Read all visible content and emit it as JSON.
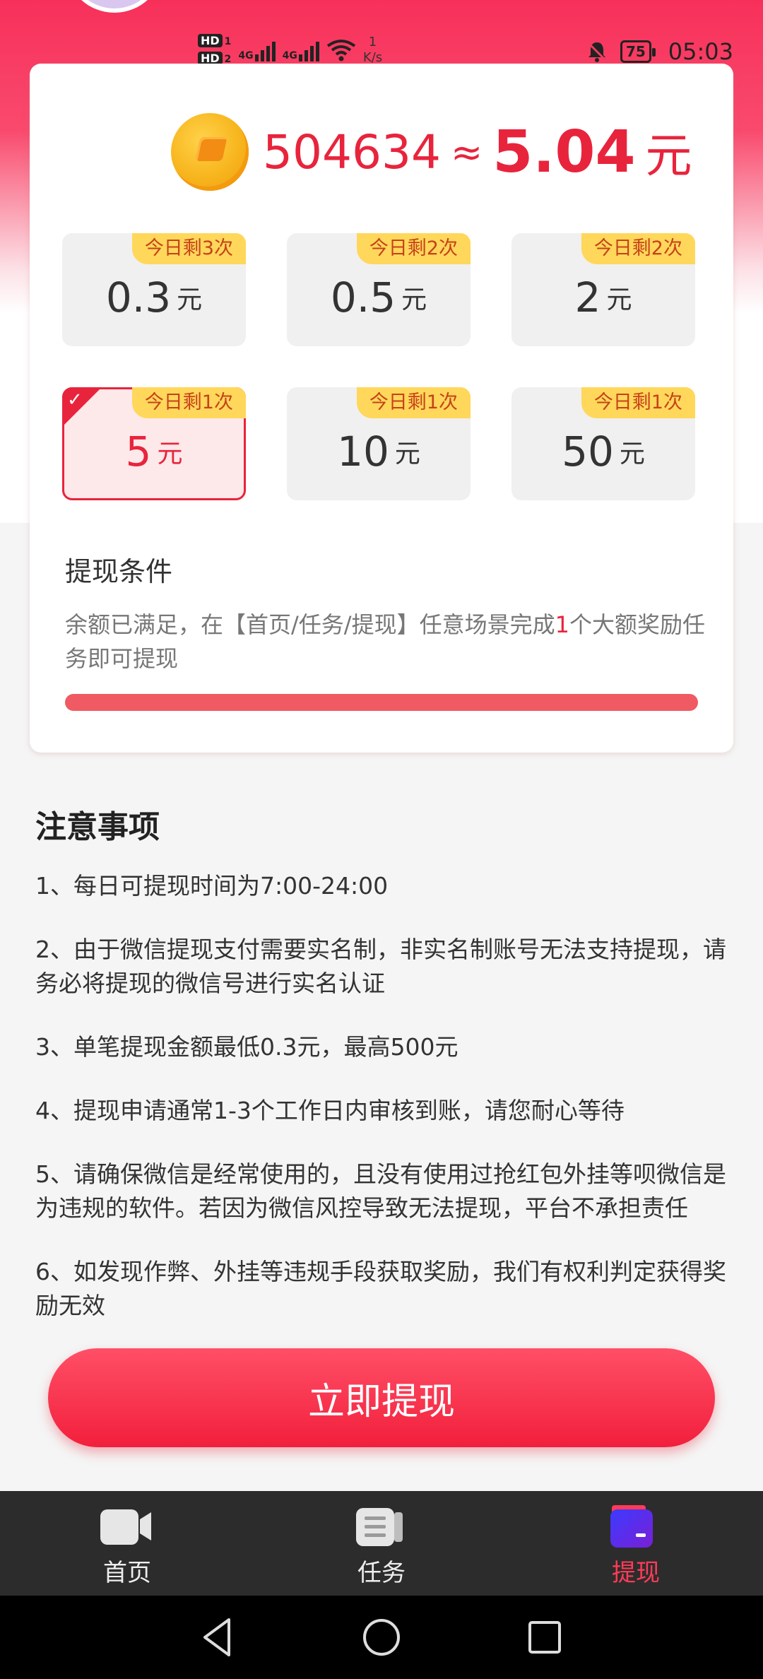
{
  "status_bar": {
    "hd1": "HD",
    "hd1_sub": "1",
    "hd2": "HD",
    "hd2_sub": "2",
    "net1": "4G",
    "net2": "4G",
    "speed_value": "1",
    "speed_unit": "K/s",
    "battery": "75",
    "time": "05:03"
  },
  "balance": {
    "coins": "504634",
    "approx": "≈",
    "amount": "5.04",
    "unit": "元"
  },
  "options": [
    {
      "badge": "今日剩3次",
      "value": "0.3",
      "unit": "元",
      "selected": false
    },
    {
      "badge": "今日剩2次",
      "value": "0.5",
      "unit": "元",
      "selected": false
    },
    {
      "badge": "今日剩2次",
      "value": "2",
      "unit": "元",
      "selected": false
    },
    {
      "badge": "今日剩1次",
      "value": "5",
      "unit": "元",
      "selected": true
    },
    {
      "badge": "今日剩1次",
      "value": "10",
      "unit": "元",
      "selected": false
    },
    {
      "badge": "今日剩1次",
      "value": "50",
      "unit": "元",
      "selected": false
    }
  ],
  "conditions": {
    "title": "提现条件",
    "text_before": "余额已满足，在【首页/任务/提现】任意场景完成",
    "highlight": "1",
    "text_after": "个大额奖励任务即可提现",
    "progress": 1.0
  },
  "notes": {
    "title": "注意事项",
    "items": [
      "1、每日可提现时间为7:00-24:00",
      "2、由于微信提现支付需要实名制，非实名制账号无法支持提现，请务必将提现的微信号进行实名认证",
      "3、单笔提现金额最低0.3元，最高500元",
      "4、提现申请通常1-3个工作日内审核到账，请您耐心等待",
      "5、请确保微信是经常使用的，且没有使用过抢红包外挂等呗微信是为违规的软件。若因为微信风控导致无法提现，平台不承担责任",
      "6、如发现作弊、外挂等违规手段获取奖励，我们有权利判定获得奖励无效"
    ]
  },
  "cta": {
    "label": "立即提现"
  },
  "tabs": [
    {
      "label": "首页",
      "icon": "video-icon",
      "active": false
    },
    {
      "label": "任务",
      "icon": "task-list-icon",
      "active": false
    },
    {
      "label": "提现",
      "icon": "wallet-icon",
      "active": true
    }
  ],
  "colors": {
    "accent": "#e8243c",
    "badge": "#ffd75a",
    "tab_active": "#ff3b57"
  }
}
